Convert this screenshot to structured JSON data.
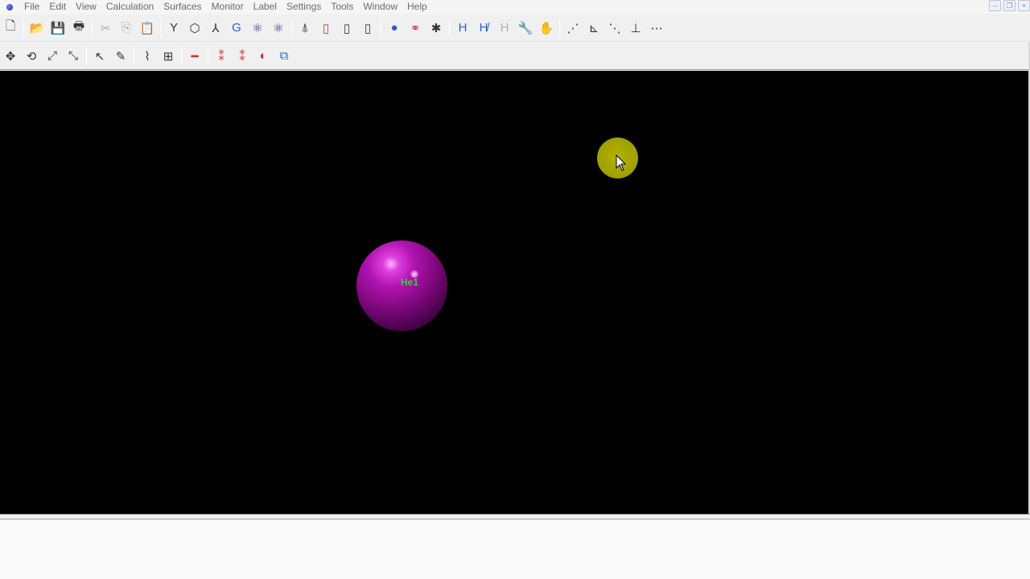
{
  "menu": [
    "File",
    "Edit",
    "View",
    "Calculation",
    "Surfaces",
    "Monitor",
    "Label",
    "Settings",
    "Tools",
    "Window",
    "Help"
  ],
  "window_controls": {
    "minimize": "–",
    "restore": "❐",
    "close": "×"
  },
  "toolbar1": [
    {
      "name": "new-icon",
      "glyph": "🗋"
    },
    {
      "sep": true
    },
    {
      "name": "open-icon",
      "glyph": "📂"
    },
    {
      "name": "save-icon",
      "glyph": "💾"
    },
    {
      "name": "print-icon",
      "glyph": "🖶"
    },
    {
      "sep": true
    },
    {
      "name": "cut-icon",
      "glyph": "✂",
      "dim": true
    },
    {
      "name": "copy-icon",
      "glyph": "⎘",
      "dim": true
    },
    {
      "name": "paste-icon",
      "glyph": "📋"
    },
    {
      "sep": true
    },
    {
      "name": "tool-y-icon",
      "glyph": "Y"
    },
    {
      "name": "tool-ring-icon",
      "glyph": "⬡"
    },
    {
      "name": "tool-branch-icon",
      "glyph": "⅄"
    },
    {
      "name": "tool-g-icon",
      "glyph": "G",
      "color": "blue"
    },
    {
      "name": "tool-molecule-icon",
      "glyph": "⚛",
      "color": "navy"
    },
    {
      "name": "tool-molecule2-icon",
      "glyph": "⚛",
      "color": "navy"
    },
    {
      "sep": true
    },
    {
      "name": "tool-bond-icon",
      "glyph": "⍋"
    },
    {
      "name": "tool-cylinder-red-icon",
      "glyph": "▯",
      "color": "red"
    },
    {
      "name": "tool-cylinder-icon",
      "glyph": "▯"
    },
    {
      "name": "tool-cylinder2-icon",
      "glyph": "▯"
    },
    {
      "sep": true
    },
    {
      "name": "atom-icon",
      "glyph": "●",
      "color": "blue"
    },
    {
      "name": "bond-pair-icon",
      "glyph": "⚭",
      "color": "red"
    },
    {
      "name": "cross-icon",
      "glyph": "✱"
    },
    {
      "sep": true
    },
    {
      "name": "hydrogen-icon",
      "glyph": "H",
      "color": "blue"
    },
    {
      "name": "hydrogen-edit-icon",
      "glyph": "H̸",
      "color": "blue"
    },
    {
      "name": "hydrogen-gray-icon",
      "glyph": "H",
      "dim": true
    },
    {
      "name": "wrench-icon",
      "glyph": "🔧"
    },
    {
      "name": "hand-icon",
      "glyph": "✋",
      "dim": true
    },
    {
      "sep": true
    },
    {
      "name": "dist-icon",
      "glyph": "⋰"
    },
    {
      "name": "angle-icon",
      "glyph": "⊾"
    },
    {
      "name": "dihedral-icon",
      "glyph": "⋱"
    },
    {
      "name": "axes-icon",
      "glyph": "⊥"
    },
    {
      "name": "connect-icon",
      "glyph": "⋯"
    }
  ],
  "toolbar2": [
    {
      "name": "translate-icon",
      "glyph": "✥"
    },
    {
      "name": "rotate-icon",
      "glyph": "⟲"
    },
    {
      "name": "scale-icon",
      "glyph": "⤢"
    },
    {
      "name": "scale2-icon",
      "glyph": "⤡"
    },
    {
      "sep": true
    },
    {
      "name": "select-arrow-icon",
      "glyph": "↖"
    },
    {
      "name": "pen-icon",
      "glyph": "✎"
    },
    {
      "sep": true
    },
    {
      "name": "measure-icon",
      "glyph": "⌇"
    },
    {
      "name": "tree-icon",
      "glyph": "⊞"
    },
    {
      "sep": true
    },
    {
      "name": "bond-line-icon",
      "glyph": "━",
      "color": "red"
    },
    {
      "sep": true
    },
    {
      "name": "dipole-icon",
      "glyph": "⁑",
      "color": "red"
    },
    {
      "name": "dipole2-icon",
      "glyph": "⁑",
      "color": "red"
    },
    {
      "name": "surface-icon",
      "glyph": "◐",
      "color": "red"
    },
    {
      "name": "box-icon",
      "glyph": "⧉",
      "color": "blue"
    }
  ],
  "viewport": {
    "background": "#000000",
    "atom": {
      "label": "He1",
      "color": "#b114b1"
    }
  }
}
